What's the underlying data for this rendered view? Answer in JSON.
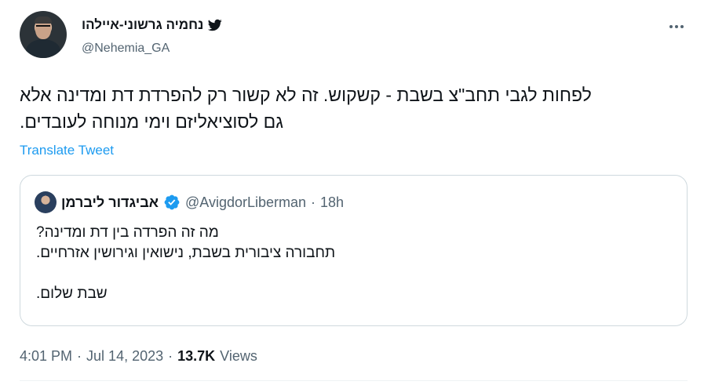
{
  "tweet": {
    "author": {
      "display_name": "נחמיה גרשוני-איילהו",
      "handle": "@Nehemia_GA",
      "badge_icon": "twitter-bird-icon",
      "badge_color": "#0f1419"
    },
    "more_icon": "more-horizontal-icon",
    "text_lines": [
      "לפחות לגבי תחב\"צ בשבת - קשקוש. זה לא קשור רק להפרדת דת ומדינה אלא",
      "גם לסוציאליזם וימי מנוחה לעובדים."
    ],
    "translate_label": "Translate Tweet",
    "quoted": {
      "display_name": "אביגדור ליברמן",
      "verified_icon": "verified-badge-icon",
      "verified_color": "#1d9bf0",
      "handle": "@AvigdorLiberman",
      "separator": "·",
      "age": "18h",
      "lines": [
        "מה זה הפרדה בין דת ומדינה?",
        "תחבורה ציבורית בשבת, נישואין וגירושין אזרחיים.",
        "",
        "שבת שלום."
      ]
    },
    "footer": {
      "time": "4:01 PM",
      "sep1": "·",
      "date": "Jul 14, 2023",
      "sep2": "·",
      "views_count": "13.7K",
      "views_label": "Views"
    }
  },
  "colors": {
    "text": "#0f1419",
    "secondary": "#536471",
    "link": "#1d9bf0",
    "border": "#cfd9de"
  }
}
